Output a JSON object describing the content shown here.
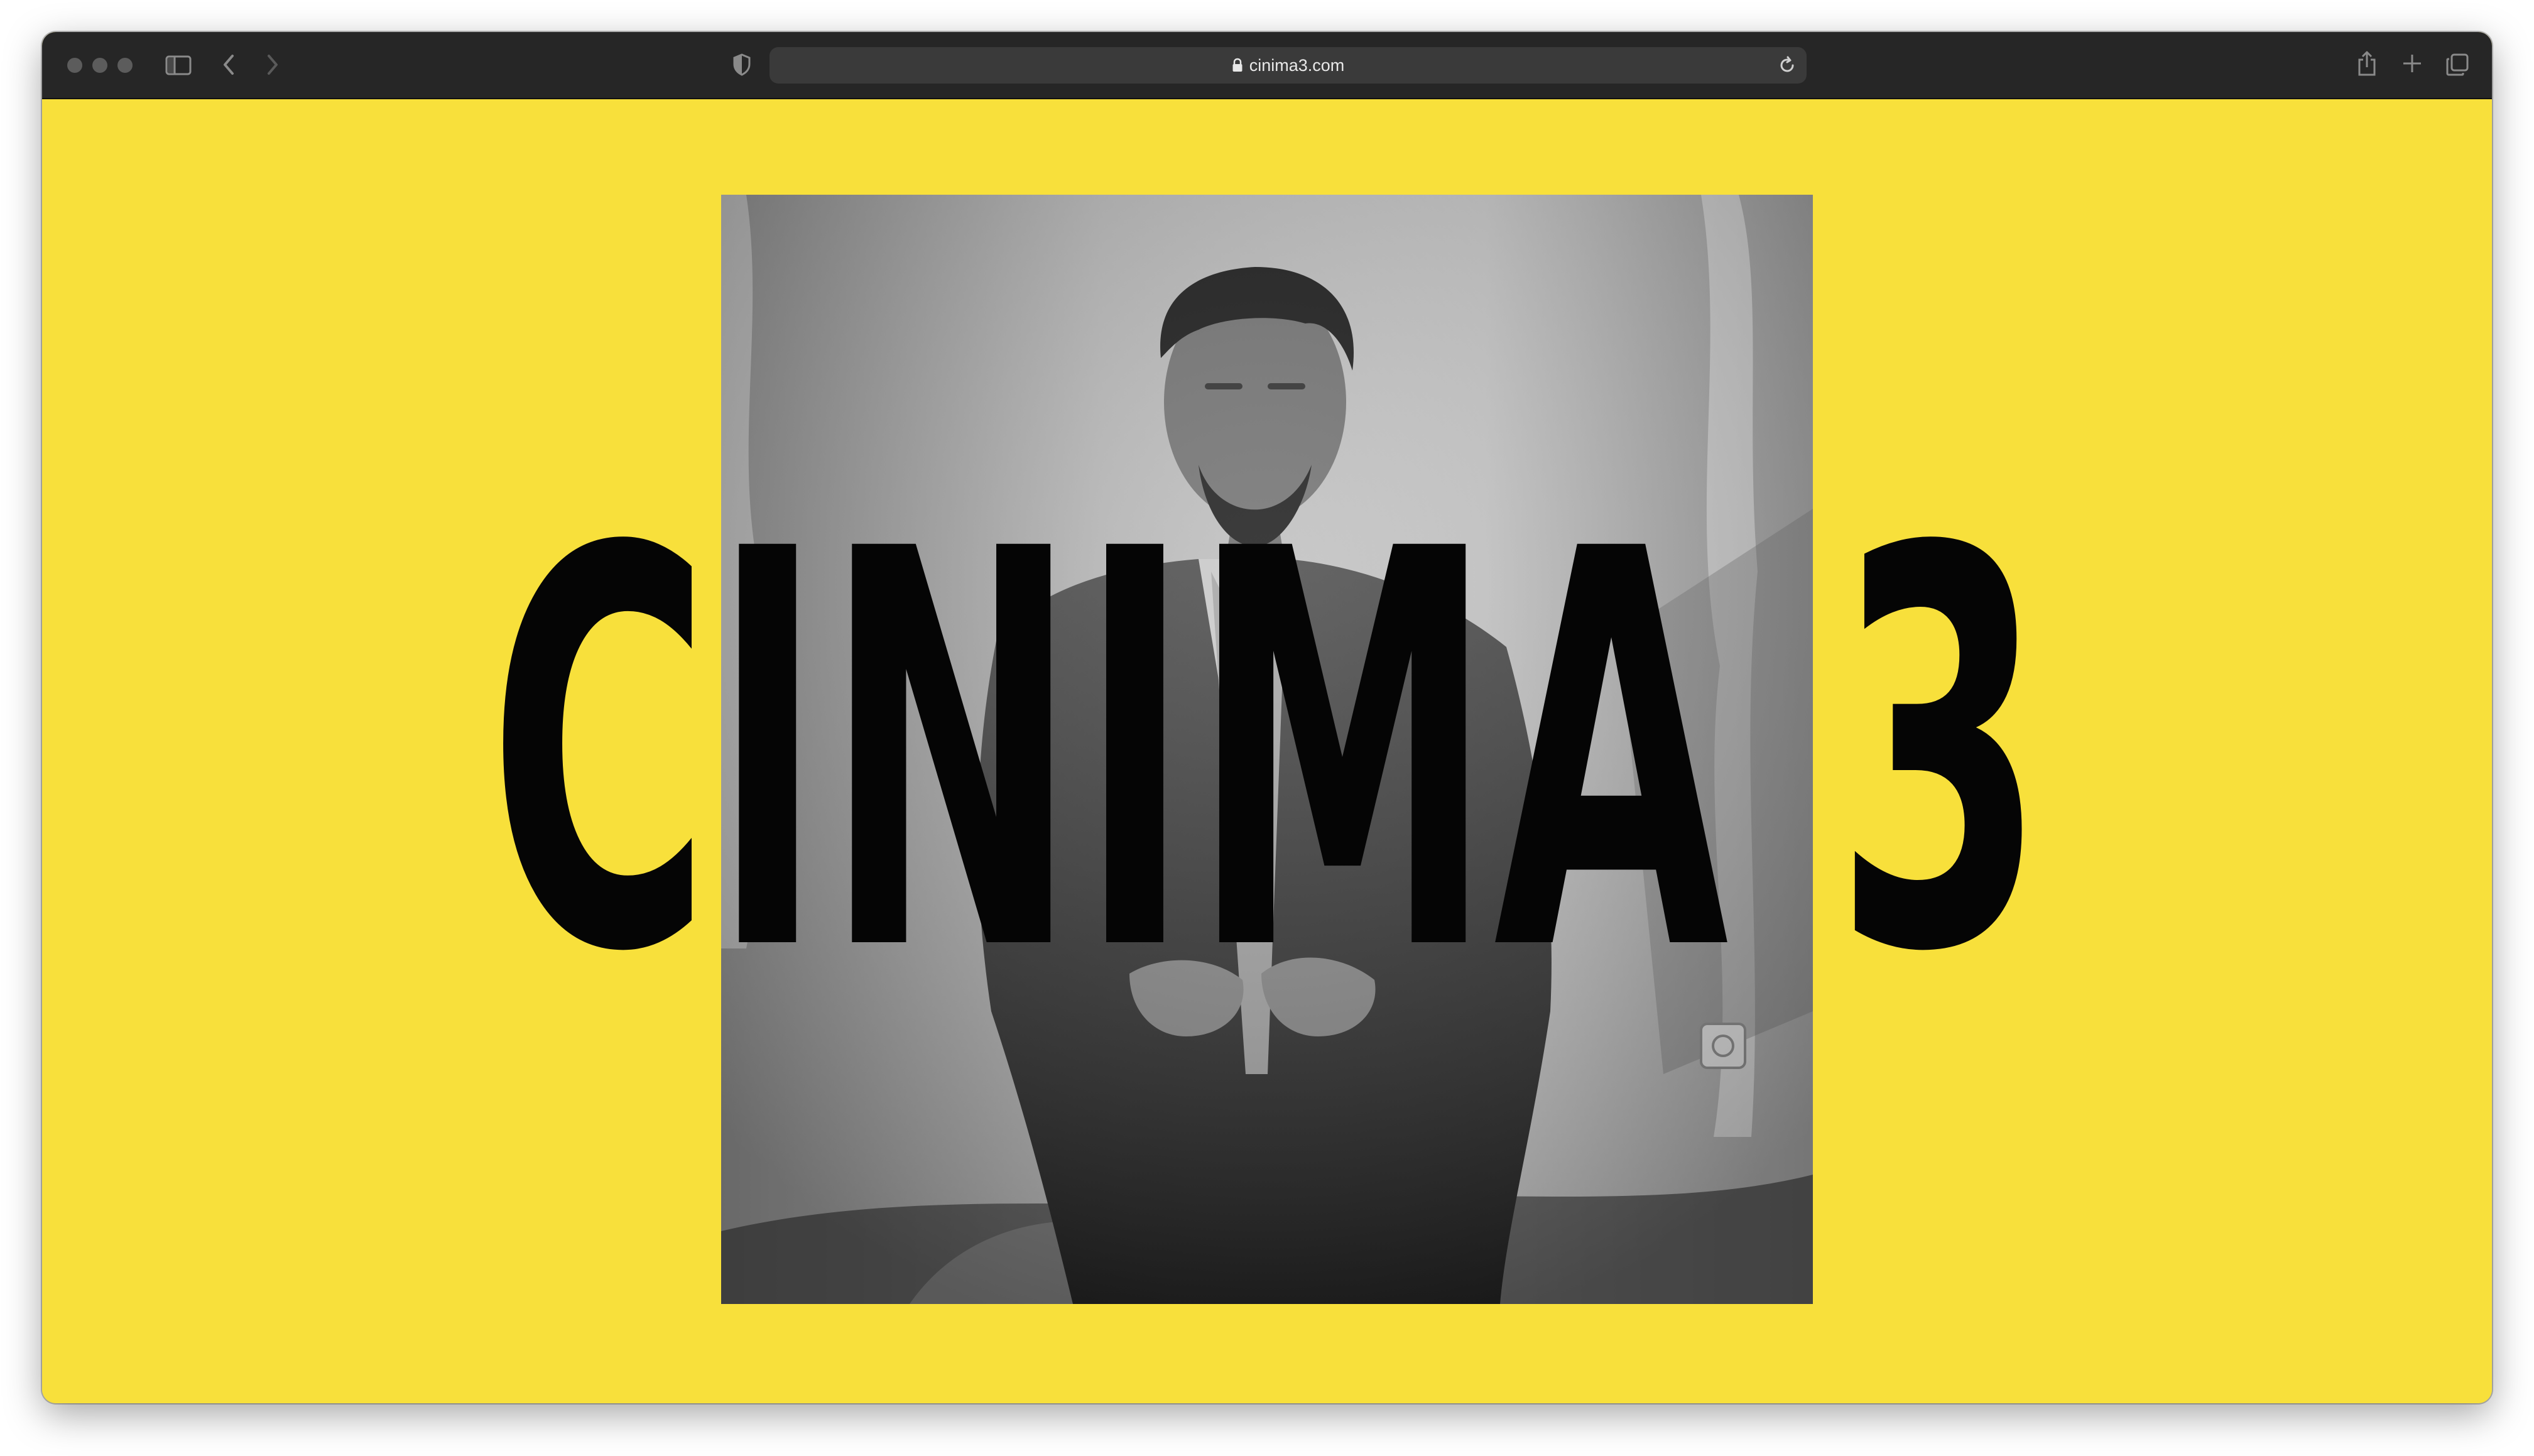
{
  "browser": {
    "url": "cinima3.com",
    "icons": {
      "sidebar": "sidebar-icon",
      "back": "chevron-left-icon",
      "forward": "chevron-right-icon",
      "privacy": "shield-icon",
      "lock": "lock-icon",
      "reload": "reload-icon",
      "share": "share-icon",
      "new_tab": "plus-icon",
      "tabs": "tabs-overview-icon"
    }
  },
  "page": {
    "background_color": "#f8e03b",
    "logo_text": "CINIMA 3",
    "hero_image": "black-and-white portrait photograph"
  }
}
